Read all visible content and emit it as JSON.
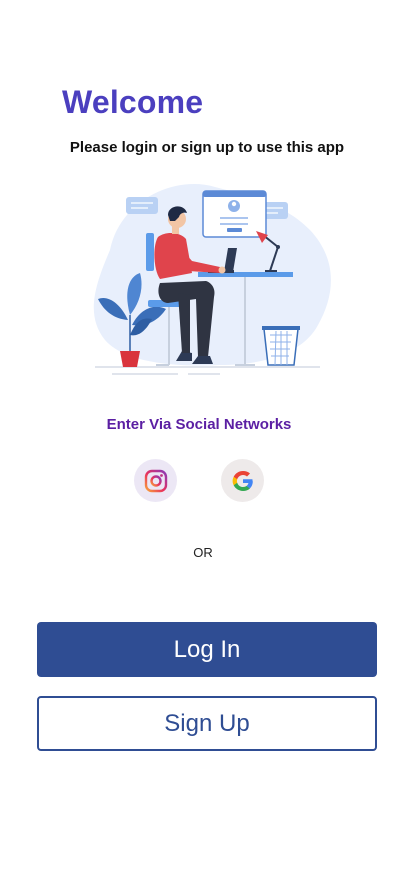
{
  "header": {
    "title": "Welcome",
    "subtitle": "Please login or sign up to use this app"
  },
  "social": {
    "title": "Enter Via Social Networks",
    "providers": [
      {
        "name": "Instagram",
        "icon": "instagram-icon"
      },
      {
        "name": "Google",
        "icon": "google-icon"
      }
    ]
  },
  "separator": "OR",
  "actions": {
    "login_label": "Log In",
    "signup_label": "Sign Up"
  },
  "colors": {
    "title": "#4b3fbf",
    "social_title": "#5b1fa3",
    "primary": "#2f4d93"
  },
  "illustration": "person-at-desk-illustration"
}
